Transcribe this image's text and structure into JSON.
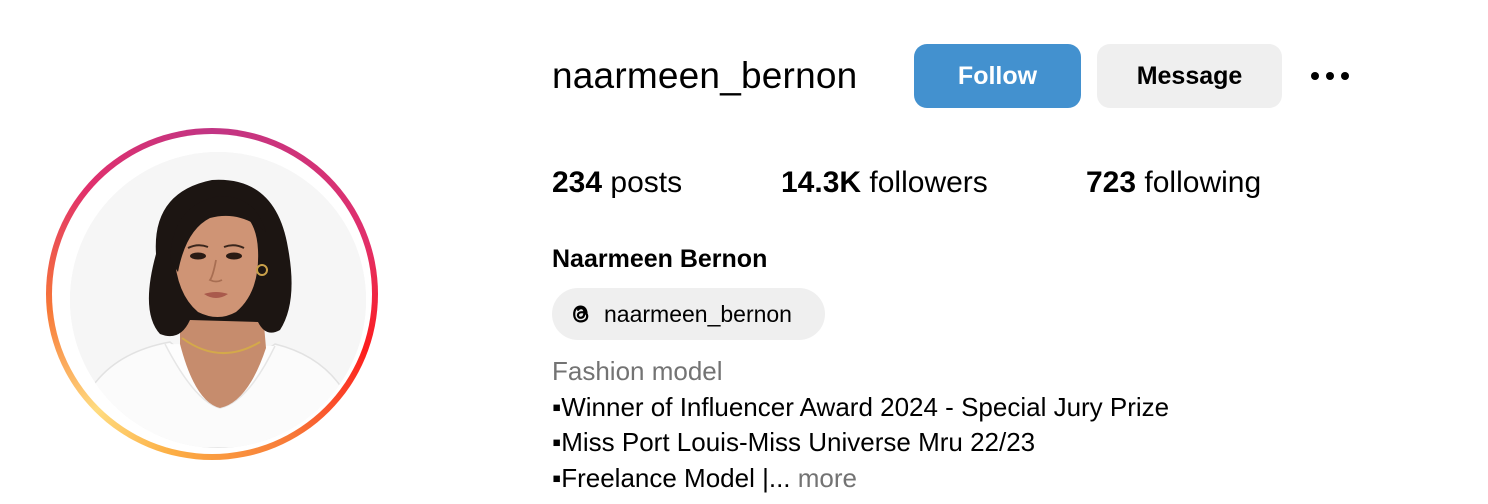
{
  "profile": {
    "username": "naarmeen_bernon",
    "full_name": "Naarmeen Bernon",
    "threads_handle": "naarmeen_bernon",
    "category": "Fashion model",
    "bio_lines": [
      "▪Winner of Influencer Award 2024 - Special Jury Prize",
      "▪Miss Port Louis-Miss Universe Mru 22/23",
      "▪Freelance Model |..."
    ],
    "more_label": "more"
  },
  "actions": {
    "follow_label": "Follow",
    "message_label": "Message"
  },
  "stats": {
    "posts_count": "234",
    "posts_label": "posts",
    "followers_count": "14.3K",
    "followers_label": "followers",
    "following_count": "723",
    "following_label": "following"
  },
  "colors": {
    "follow_button": "#4391cf",
    "secondary_button": "#efefef",
    "muted_text": "#737373"
  },
  "icons": {
    "avatar": "profile-photo",
    "threads": "threads-logo-icon",
    "more": "more-options-icon"
  }
}
